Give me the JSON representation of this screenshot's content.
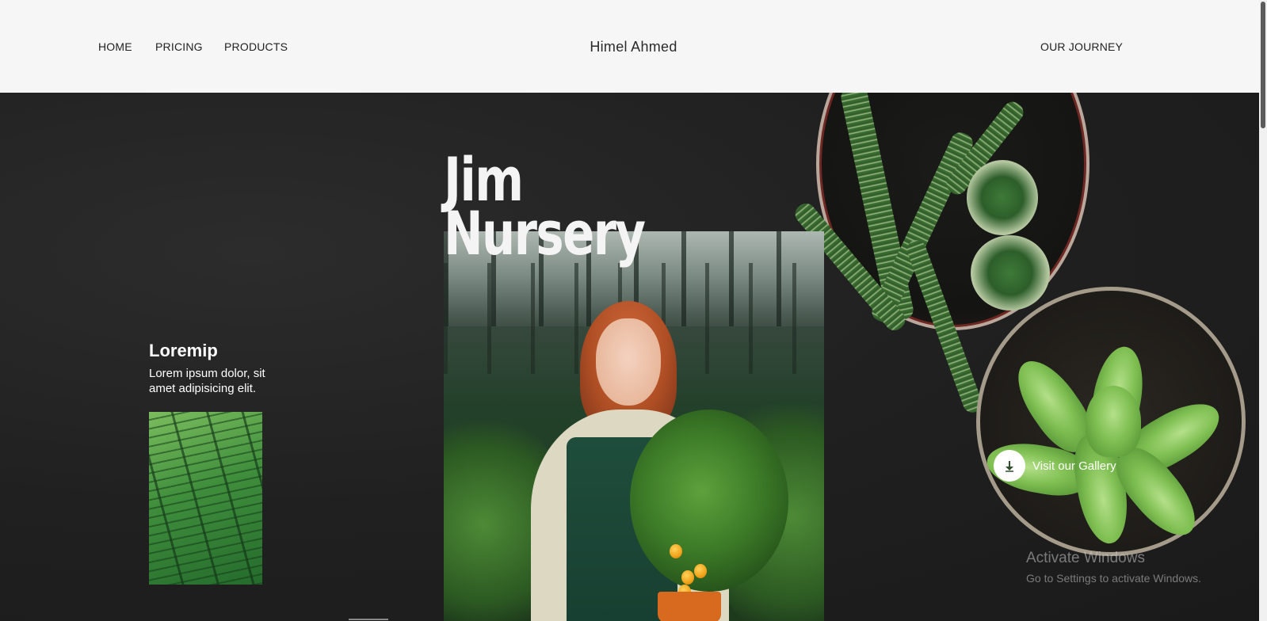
{
  "nav": {
    "home": "HOME",
    "pricing": "PRICING",
    "products": "PRODUCTS",
    "brand": "Himel Ahmed",
    "journey": "OUR JOURNEY"
  },
  "hero": {
    "title_line1": "Jim",
    "title_line2": "Nursery"
  },
  "card": {
    "title": "Loremip",
    "text": "Lorem ipsum dolor, sit amet adipisicing elit."
  },
  "gallery": {
    "label": "Visit our Gallery",
    "icon": "arrow-down-icon"
  },
  "watermark": {
    "title": "Activate Windows",
    "subtitle": "Go to Settings to activate Windows."
  },
  "colors": {
    "header_bg": "#f6f6f6",
    "hero_bg": "#1e1e1e",
    "text_light": "#ffffff",
    "arrow": "#2f4f2a"
  }
}
